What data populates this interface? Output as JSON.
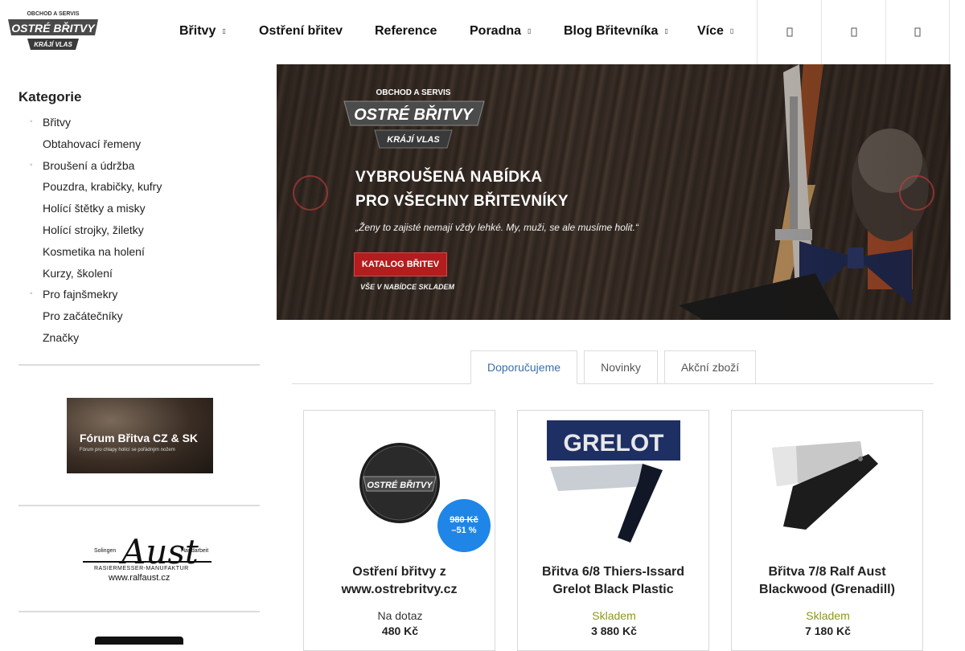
{
  "header": {
    "logo": {
      "top": "OBCHOD A SERVIS",
      "main": "OSTRÉ BŘITVY",
      "bottom": "KRÁJÍ VLAS"
    },
    "nav": [
      {
        "label": "Břitvy",
        "has_submenu": true
      },
      {
        "label": "Ostření břitev",
        "has_submenu": false
      },
      {
        "label": "Reference",
        "has_submenu": false
      },
      {
        "label": "Poradna",
        "has_submenu": true
      },
      {
        "label": "Blog Břitevníka",
        "has_submenu": true
      },
      {
        "label": "Více",
        "has_submenu": true
      }
    ],
    "icons": [
      "search-icon",
      "user-icon",
      "cart-icon"
    ]
  },
  "sidebar": {
    "title": "Kategorie",
    "categories": [
      {
        "label": "Břitvy",
        "expandable": true
      },
      {
        "label": "Obtahovací řemeny",
        "expandable": false
      },
      {
        "label": "Broušení a údržba",
        "expandable": true
      },
      {
        "label": "Pouzdra, krabičky, kufry",
        "expandable": false
      },
      {
        "label": "Holící štětky a misky",
        "expandable": false
      },
      {
        "label": "Holící strojky, žiletky",
        "expandable": false
      },
      {
        "label": "Kosmetika na holení",
        "expandable": false
      },
      {
        "label": "Kurzy, školení",
        "expandable": false
      },
      {
        "label": "Pro fajnšmekry",
        "expandable": true
      },
      {
        "label": "Pro začátečníky",
        "expandable": false
      },
      {
        "label": "Značky",
        "expandable": false
      }
    ],
    "banner_forum": {
      "title": "Fórum Břitva CZ & SK",
      "subtitle": "Fórum pro chlapy holící se pořádným nožem"
    },
    "banner_aust": {
      "brand": "Aust",
      "left": "Solingen",
      "right": "Handarbeit",
      "sub": "RASIERMESSER-MANUFAKTUR",
      "url": "www.ralfaust.cz"
    }
  },
  "hero": {
    "logo": {
      "top": "OBCHOD A SERVIS",
      "main": "OSTRÉ BŘITVY",
      "bottom": "KRÁJÍ VLAS"
    },
    "line1": "VYBROUŠENÁ NABÍDKA",
    "line2": "PRO VŠECHNY BŘITEVNÍKY",
    "quote": "„Ženy to zajisté nemají vždy lehké. My, muži, se ale musíme holit.“",
    "cta": "KATALOG BŘITEV",
    "cta_sub": "VŠE V NABÍDCE SKLADEM"
  },
  "tabs": [
    {
      "label": "Doporučujeme",
      "active": true
    },
    {
      "label": "Novinky",
      "active": false
    },
    {
      "label": "Akční zboží",
      "active": false
    }
  ],
  "products": [
    {
      "name": "Ostření břitvy z www.ostrebritvy.cz",
      "availability": "Na dotaz",
      "availability_color": "#333333",
      "price": "480 Kč",
      "old_price": "980 Kč",
      "discount": "–51 %",
      "image": "ostre-britvy-logo",
      "image_text": "OSTRÉ BŘITVY"
    },
    {
      "name": "Břitva 6/8 Thiers-Issard Grelot Black Plastic",
      "availability": "Skladem",
      "availability_color": "#8a9a18",
      "price": "3 880 Kč",
      "image": "razor-grelot",
      "image_text": "GRELOT"
    },
    {
      "name": "Břitva 7/8 Ralf Aust Blackwood (Grenadill)",
      "availability": "Skladem",
      "availability_color": "#8a9a18",
      "price": "7 180 Kč",
      "image": "razor-aust-blackwood"
    }
  ],
  "colors": {
    "accent_blue": "#3a6ea8",
    "badge_blue": "#1f86e8",
    "cta_red": "#b31d1d",
    "in_stock": "#8a9a18"
  }
}
